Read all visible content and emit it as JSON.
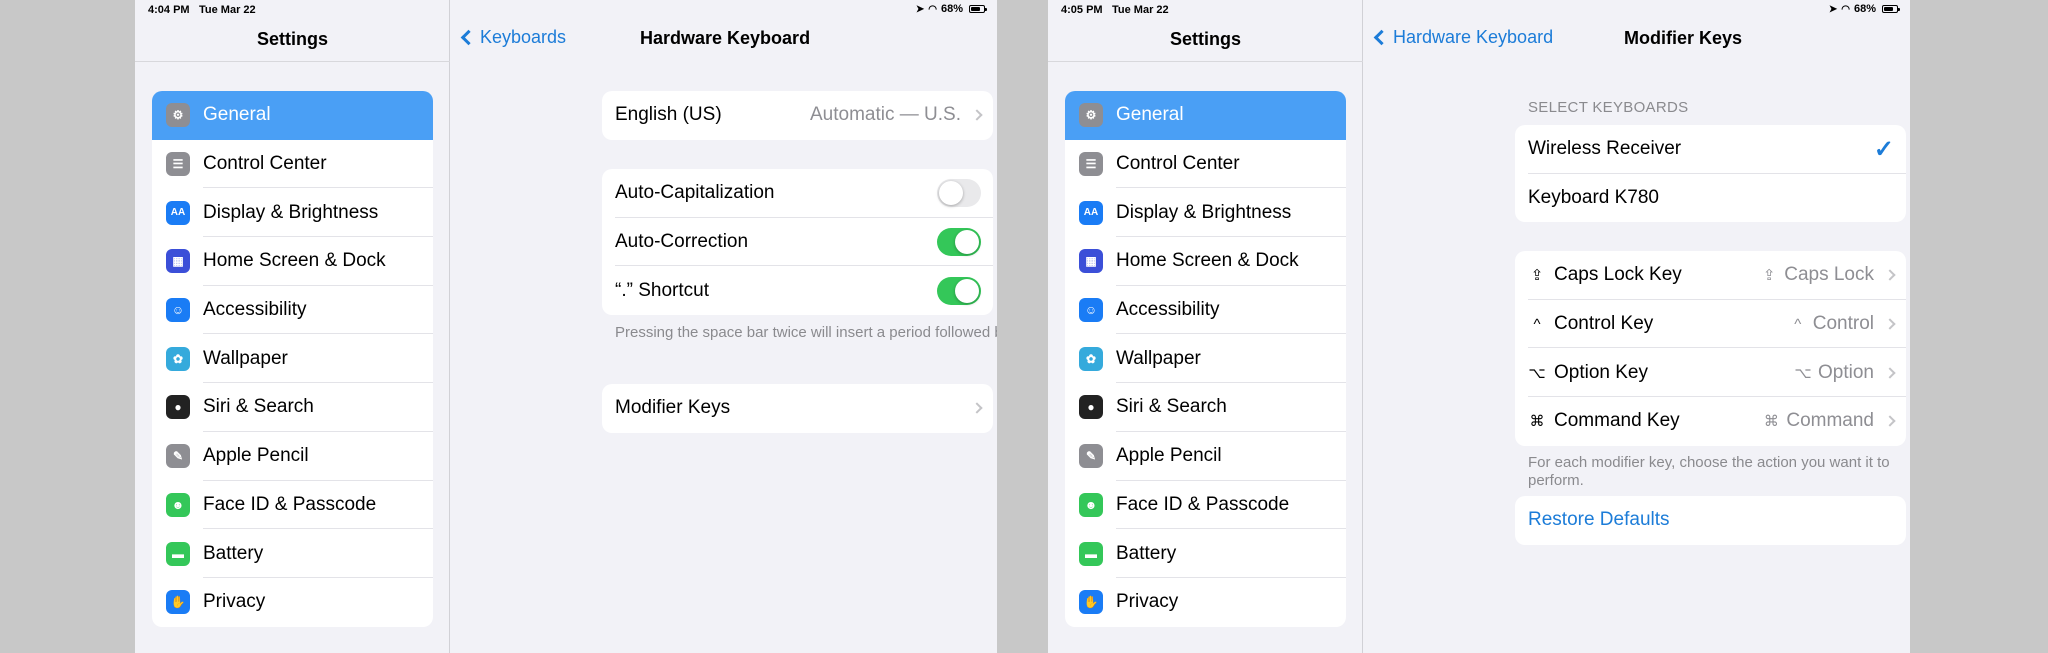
{
  "left": {
    "status": {
      "time": "4:04 PM",
      "date": "Tue Mar 22",
      "battery": "68%"
    },
    "sidebar_title": "Settings",
    "nav": {
      "back_label": "Keyboards",
      "title": "Hardware Keyboard"
    },
    "language": {
      "label": "English (US)",
      "value": "Automatic — U.S."
    },
    "toggles": [
      {
        "label": "Auto-Capitalization",
        "on": false
      },
      {
        "label": "Auto-Correction",
        "on": true
      },
      {
        "label": "“.” Shortcut",
        "on": true
      }
    ],
    "toggles_footer": "Pressing the space bar twice will insert a period followed by a space.",
    "modifier_keys_label": "Modifier Keys"
  },
  "right": {
    "status": {
      "time": "4:05 PM",
      "date": "Tue Mar 22",
      "battery": "68%"
    },
    "sidebar_title": "Settings",
    "nav": {
      "back_label": "Hardware Keyboard",
      "title": "Modifier Keys"
    },
    "select_header": "SELECT KEYBOARDS",
    "keyboards": [
      {
        "label": "Wireless Receiver",
        "checked": true
      },
      {
        "label": "Keyboard K780",
        "checked": false
      }
    ],
    "modifiers": [
      {
        "symbol": "⇪",
        "label": "Caps Lock Key",
        "value_symbol": "⇪",
        "value": "Caps Lock"
      },
      {
        "symbol": "^",
        "label": "Control Key",
        "value_symbol": "^",
        "value": "Control"
      },
      {
        "symbol": "⌥",
        "label": "Option Key",
        "value_symbol": "⌥",
        "value": "Option"
      },
      {
        "symbol": "⌘",
        "label": "Command Key",
        "value_symbol": "⌘",
        "value": "Command"
      }
    ],
    "modifiers_footer": "For each modifier key, choose the action you want it to perform.",
    "restore_label": "Restore Defaults"
  },
  "sidebar_items": [
    {
      "label": "General",
      "icon": "gear-icon",
      "color": "#8e8e93",
      "selected": true
    },
    {
      "label": "Control Center",
      "icon": "switches-icon",
      "color": "#8e8e93"
    },
    {
      "label": "Display & Brightness",
      "icon": "text-size-icon",
      "color": "#1a7cf5"
    },
    {
      "label": "Home Screen & Dock",
      "icon": "app-grid-icon",
      "color": "#3b4fd8"
    },
    {
      "label": "Accessibility",
      "icon": "accessibility-icon",
      "color": "#1a7cf5"
    },
    {
      "label": "Wallpaper",
      "icon": "flower-icon",
      "color": "#35aadc"
    },
    {
      "label": "Siri & Search",
      "icon": "siri-icon",
      "color": "#222222"
    },
    {
      "label": "Apple Pencil",
      "icon": "pencil-icon",
      "color": "#8e8e93"
    },
    {
      "label": "Face ID & Passcode",
      "icon": "face-id-icon",
      "color": "#34c759"
    },
    {
      "label": "Battery",
      "icon": "battery-icon",
      "color": "#34c759"
    },
    {
      "label": "Privacy",
      "icon": "hand-icon",
      "color": "#1a7cf5"
    }
  ]
}
